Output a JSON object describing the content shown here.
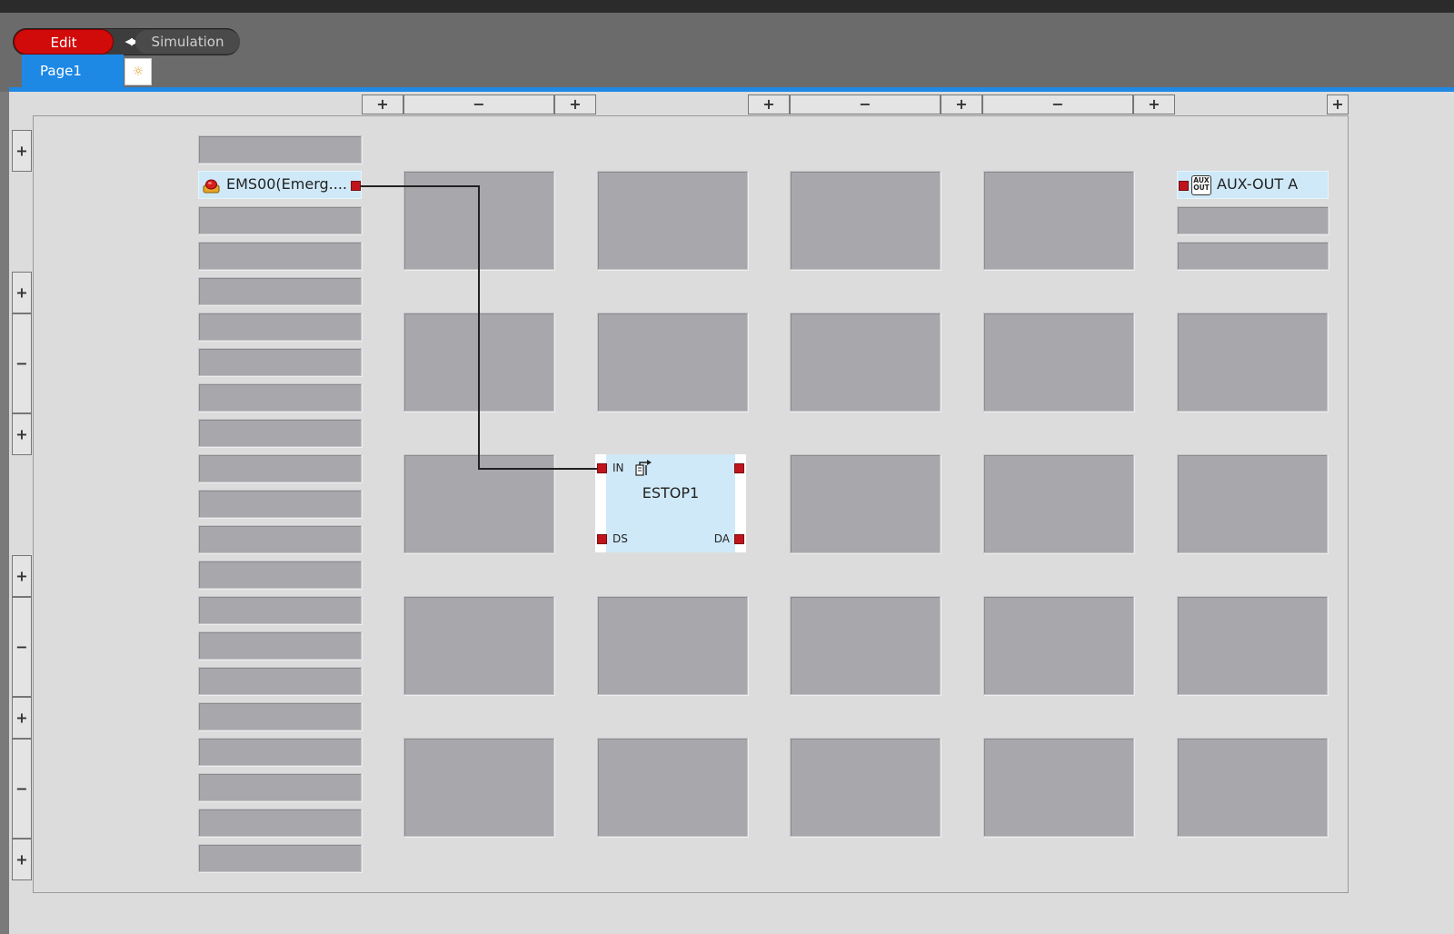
{
  "toolbar": {
    "edit_label": "Edit",
    "simulation_label": "Simulation",
    "swap_icon": "◀▶"
  },
  "tabs": {
    "page1_label": "Page1",
    "new_page_icon": "☼"
  },
  "column_controls": [
    "+",
    "−",
    "+",
    "+",
    "−",
    "+",
    "−",
    "+",
    "+"
  ],
  "row_controls": [
    "+",
    "+",
    "−",
    "+",
    "+",
    "−",
    "+",
    "−",
    "+"
  ],
  "inputs": {
    "filled_item": "EMS00(Emerg...."
  },
  "outputs": {
    "filled_item": "AUX-OUT A",
    "icon_text_top": "AUX",
    "icon_text_bottom": "OUT"
  },
  "function_block": {
    "name": "ESTOP1",
    "in_label": "IN",
    "ds_label": "DS",
    "da_label": "DA"
  },
  "colors": {
    "edit_active": "#d10a0a",
    "tab_accent": "#1e88e5",
    "port": "#c0141c",
    "filled_slot": "#cfe9f8"
  }
}
